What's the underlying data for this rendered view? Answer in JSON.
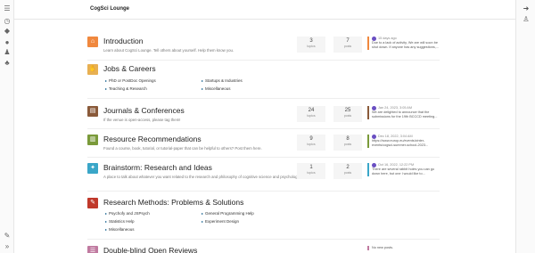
{
  "brand": "CogSci Lounge",
  "left_rail_icons": [
    "list-icon",
    "clock-icon",
    "tags-icon",
    "fire-icon",
    "user-icon",
    "users-icon",
    "pencil-icon",
    "expand-icon"
  ],
  "right_rail_icons": [
    "login-icon",
    "add-user-icon"
  ],
  "categories": [
    {
      "id": "introduction",
      "title": "Introduction",
      "description": "Learn about CogSci Lounge. Tell others about yourself. Help them know you.",
      "color": "#f0883e",
      "icon": "door-icon",
      "glyph": "⌂",
      "topics": "3",
      "posts": "7",
      "topics_label": "topics",
      "posts_label": "posts",
      "latest_time": "15 days ago",
      "latest_text": "Due to a lack of activity, We are will soon be shut down. If anyone has any suggestions,..."
    },
    {
      "id": "jobs",
      "title": "Jobs & Careers",
      "color": "#e8b052",
      "icon": "handshake-icon",
      "glyph": "✋",
      "subcats": [
        "PhD or PostDoc Openings",
        "Startups & Industries",
        "Teaching & Research",
        "Miscellaneous"
      ]
    },
    {
      "id": "journals",
      "title": "Journals & Conferences",
      "description": "If the venue is open-access, please tag them!",
      "color": "#8a5a3a",
      "icon": "book-icon",
      "glyph": "▤",
      "topics": "24",
      "posts": "25",
      "topics_label": "topics",
      "posts_label": "posts",
      "latest_time": "Jan 24, 2023, 3:05 AM",
      "latest_text": "We are delighted to announce that the submissions for the 19th BCCCD meeting..."
    },
    {
      "id": "resources",
      "title": "Resource Recommendations",
      "description": "Found a course, book, tutorial, or tutorial-paper that can be helpful to others? Post them here.",
      "color": "#7a9a3a",
      "icon": "book-open-icon",
      "glyph": "▥",
      "topics": "9",
      "posts": "8",
      "topics_label": "topics",
      "posts_label": "posts",
      "latest_time": "Dec 18, 2022, 3:04 AM",
      "latest_text": "https://www.europ.eu/events/zinter-events/cogsci-summer-school-2023..."
    },
    {
      "id": "brainstorm",
      "title": "Brainstorm: Research and Ideas",
      "description": "A place to talk about whatever you want related to the research and philosophy of cognitive science and psychology.",
      "color": "#3aa6c8",
      "icon": "lightbulb-icon",
      "glyph": "✦",
      "topics": "1",
      "posts": "2",
      "topics_label": "topics",
      "posts_label": "posts",
      "latest_time": "Oct 16, 2022, 12:22 PM",
      "latest_text": "There are several rabbit holes you can go down here, but one I would like to..."
    },
    {
      "id": "methods",
      "title": "Research Methods: Problems & Solutions",
      "color": "#c0392b",
      "icon": "wrench-icon",
      "glyph": "✎",
      "subcats": [
        "Psychofy and JSPsych",
        "General Programming Help",
        "Statistics Help",
        "Experiment Design",
        "Miscellaneous"
      ]
    },
    {
      "id": "reviews",
      "title": "Double-blind Open Reviews",
      "color": "#c07aa0",
      "icon": "review-icon",
      "glyph": "☰",
      "latest_text": "No new posts."
    }
  ]
}
